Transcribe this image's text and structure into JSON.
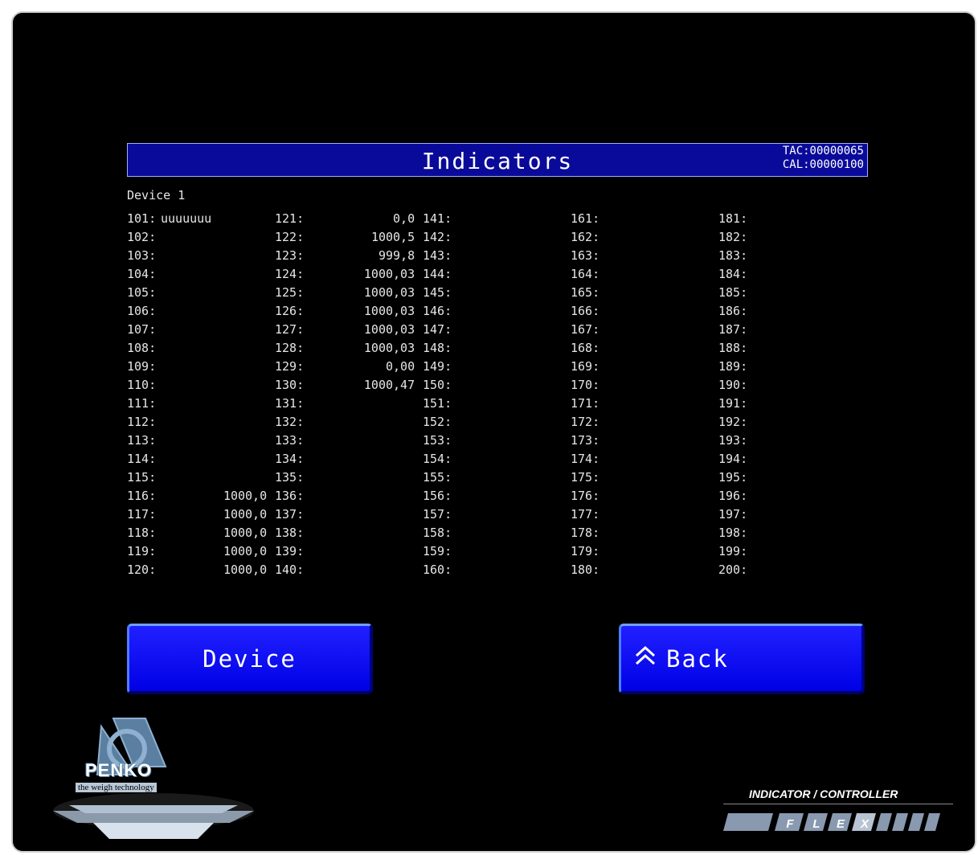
{
  "header": {
    "title": "Indicators",
    "tac": "TAC:00000065",
    "cal": "CAL:00000100"
  },
  "device_label": "Device 1",
  "columns": [
    [
      {
        "id": "101:",
        "value": "uuuuuuu"
      },
      {
        "id": "102:",
        "value": ""
      },
      {
        "id": "103:",
        "value": ""
      },
      {
        "id": "104:",
        "value": ""
      },
      {
        "id": "105:",
        "value": ""
      },
      {
        "id": "106:",
        "value": ""
      },
      {
        "id": "107:",
        "value": ""
      },
      {
        "id": "108:",
        "value": ""
      },
      {
        "id": "109:",
        "value": ""
      },
      {
        "id": "110:",
        "value": ""
      },
      {
        "id": "111:",
        "value": ""
      },
      {
        "id": "112:",
        "value": ""
      },
      {
        "id": "113:",
        "value": ""
      },
      {
        "id": "114:",
        "value": ""
      },
      {
        "id": "115:",
        "value": ""
      },
      {
        "id": "116:",
        "value": "1000,0"
      },
      {
        "id": "117:",
        "value": "1000,0"
      },
      {
        "id": "118:",
        "value": "1000,0"
      },
      {
        "id": "119:",
        "value": "1000,0"
      },
      {
        "id": "120:",
        "value": "1000,0"
      }
    ],
    [
      {
        "id": "121:",
        "value": "0,0"
      },
      {
        "id": "122:",
        "value": "1000,5"
      },
      {
        "id": "123:",
        "value": "999,8"
      },
      {
        "id": "124:",
        "value": "1000,03"
      },
      {
        "id": "125:",
        "value": "1000,03"
      },
      {
        "id": "126:",
        "value": "1000,03"
      },
      {
        "id": "127:",
        "value": "1000,03"
      },
      {
        "id": "128:",
        "value": "1000,03"
      },
      {
        "id": "129:",
        "value": "0,00"
      },
      {
        "id": "130:",
        "value": "1000,47"
      },
      {
        "id": "131:",
        "value": ""
      },
      {
        "id": "132:",
        "value": ""
      },
      {
        "id": "133:",
        "value": ""
      },
      {
        "id": "134:",
        "value": ""
      },
      {
        "id": "135:",
        "value": ""
      },
      {
        "id": "136:",
        "value": ""
      },
      {
        "id": "137:",
        "value": ""
      },
      {
        "id": "138:",
        "value": ""
      },
      {
        "id": "139:",
        "value": ""
      },
      {
        "id": "140:",
        "value": ""
      }
    ],
    [
      {
        "id": "141:",
        "value": ""
      },
      {
        "id": "142:",
        "value": ""
      },
      {
        "id": "143:",
        "value": ""
      },
      {
        "id": "144:",
        "value": ""
      },
      {
        "id": "145:",
        "value": ""
      },
      {
        "id": "146:",
        "value": ""
      },
      {
        "id": "147:",
        "value": ""
      },
      {
        "id": "148:",
        "value": ""
      },
      {
        "id": "149:",
        "value": ""
      },
      {
        "id": "150:",
        "value": ""
      },
      {
        "id": "151:",
        "value": ""
      },
      {
        "id": "152:",
        "value": ""
      },
      {
        "id": "153:",
        "value": ""
      },
      {
        "id": "154:",
        "value": ""
      },
      {
        "id": "155:",
        "value": ""
      },
      {
        "id": "156:",
        "value": ""
      },
      {
        "id": "157:",
        "value": ""
      },
      {
        "id": "158:",
        "value": ""
      },
      {
        "id": "159:",
        "value": ""
      },
      {
        "id": "160:",
        "value": ""
      }
    ],
    [
      {
        "id": "161:",
        "value": ""
      },
      {
        "id": "162:",
        "value": ""
      },
      {
        "id": "163:",
        "value": ""
      },
      {
        "id": "164:",
        "value": ""
      },
      {
        "id": "165:",
        "value": ""
      },
      {
        "id": "166:",
        "value": ""
      },
      {
        "id": "167:",
        "value": ""
      },
      {
        "id": "168:",
        "value": ""
      },
      {
        "id": "169:",
        "value": ""
      },
      {
        "id": "170:",
        "value": ""
      },
      {
        "id": "171:",
        "value": ""
      },
      {
        "id": "172:",
        "value": ""
      },
      {
        "id": "173:",
        "value": ""
      },
      {
        "id": "174:",
        "value": ""
      },
      {
        "id": "175:",
        "value": ""
      },
      {
        "id": "176:",
        "value": ""
      },
      {
        "id": "177:",
        "value": ""
      },
      {
        "id": "178:",
        "value": ""
      },
      {
        "id": "179:",
        "value": ""
      },
      {
        "id": "180:",
        "value": ""
      }
    ],
    [
      {
        "id": "181:",
        "value": ""
      },
      {
        "id": "182:",
        "value": ""
      },
      {
        "id": "183:",
        "value": ""
      },
      {
        "id": "184:",
        "value": ""
      },
      {
        "id": "185:",
        "value": ""
      },
      {
        "id": "186:",
        "value": ""
      },
      {
        "id": "187:",
        "value": ""
      },
      {
        "id": "188:",
        "value": ""
      },
      {
        "id": "189:",
        "value": ""
      },
      {
        "id": "190:",
        "value": ""
      },
      {
        "id": "191:",
        "value": ""
      },
      {
        "id": "192:",
        "value": ""
      },
      {
        "id": "193:",
        "value": ""
      },
      {
        "id": "194:",
        "value": ""
      },
      {
        "id": "195:",
        "value": ""
      },
      {
        "id": "196:",
        "value": ""
      },
      {
        "id": "197:",
        "value": ""
      },
      {
        "id": "198:",
        "value": ""
      },
      {
        "id": "199:",
        "value": ""
      },
      {
        "id": "200:",
        "value": ""
      }
    ]
  ],
  "buttons": {
    "device": "Device",
    "back": "Back",
    "back_icon": "double-chevron-up-icon"
  },
  "branding": {
    "penko": "PENKO",
    "penko_sub": "the weigh technology",
    "caption": "INDICATOR / CONTROLLER",
    "product_letters": [
      "F",
      "L",
      "E",
      "X"
    ]
  },
  "colors": {
    "background": "#000000",
    "title_bar": "#0a0a9a",
    "button": "#0000e6",
    "text": "#e6e6e6"
  }
}
